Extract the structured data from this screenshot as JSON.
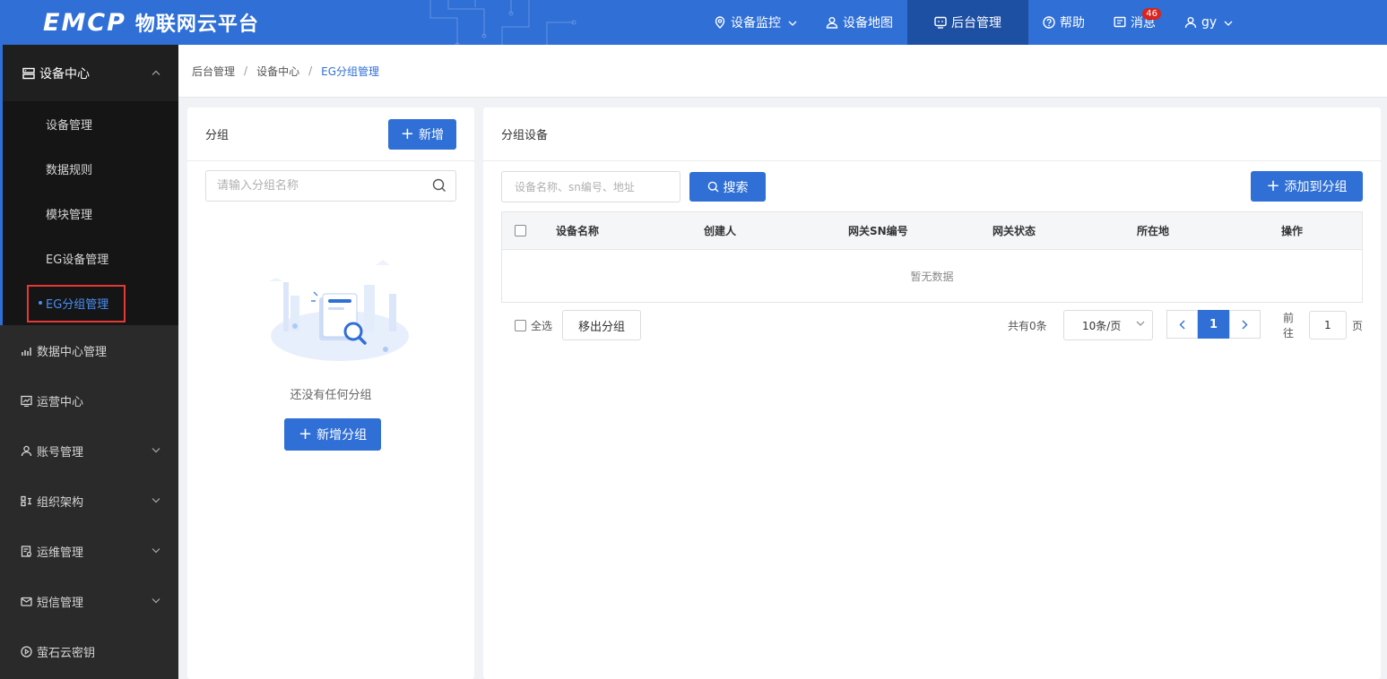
{
  "brand": {
    "mark": "EMCP",
    "name": "物联网云平台"
  },
  "nav": {
    "items": [
      {
        "label": "设备监控",
        "icon": "location-pin-icon",
        "has_menu": true
      },
      {
        "label": "设备地图",
        "icon": "person-map-icon",
        "has_menu": false
      },
      {
        "label": "后台管理",
        "icon": "monitor-icon",
        "has_menu": false,
        "active": true
      },
      {
        "label": "帮助",
        "icon": "help-circle-icon",
        "has_menu": false
      },
      {
        "label": "消息",
        "icon": "message-icon",
        "badge": "46"
      },
      {
        "label": "gy",
        "icon": "user-icon",
        "has_menu": true
      }
    ]
  },
  "sidebar": {
    "group": {
      "label": "设备中心",
      "icon": "device-center-icon"
    },
    "sub_items": [
      {
        "label": "设备管理"
      },
      {
        "label": "数据规则"
      },
      {
        "label": "模块管理"
      },
      {
        "label": "EG设备管理"
      },
      {
        "label": "EG分组管理",
        "active": true
      }
    ],
    "items": [
      {
        "label": "数据中心管理",
        "icon": "chart-icon",
        "chevron": false
      },
      {
        "label": "运营中心",
        "icon": "trend-icon",
        "chevron": false
      },
      {
        "label": "账号管理",
        "icon": "user-icon",
        "chevron": true
      },
      {
        "label": "组织架构",
        "icon": "org-icon",
        "chevron": true
      },
      {
        "label": "运维管理",
        "icon": "ops-icon",
        "chevron": true
      },
      {
        "label": "短信管理",
        "icon": "mail-icon",
        "chevron": true
      },
      {
        "label": "萤石云密钥",
        "icon": "play-circle-icon",
        "chevron": false
      }
    ]
  },
  "breadcrumb": [
    "后台管理",
    "设备中心",
    "EG分组管理"
  ],
  "group_panel": {
    "title": "分组",
    "add_label": "新增",
    "search_placeholder": "请输入分组名称",
    "empty_text": "还没有任何分组",
    "empty_button": "新增分组"
  },
  "device_panel": {
    "title": "分组设备",
    "search_placeholder": "设备名称、sn编号、地址",
    "search_label": "搜索",
    "add_to_group_label": "添加到分组",
    "columns": [
      "设备名称",
      "创建人",
      "网关SN编号",
      "网关状态",
      "所在地",
      "操作"
    ],
    "empty_text": "暂无数据",
    "select_all_label": "全选",
    "remove_label": "移出分组",
    "total_text": "共有0条",
    "page_size": "10条/页",
    "current_page": "1",
    "goto_prefix": "前往",
    "goto_value": "1",
    "goto_suffix": "页"
  },
  "colors": {
    "primary": "#2f6fd6",
    "header_active": "#1d4fa3",
    "sidebar_bg": "#2a2a2a",
    "badge": "#d9251d"
  }
}
